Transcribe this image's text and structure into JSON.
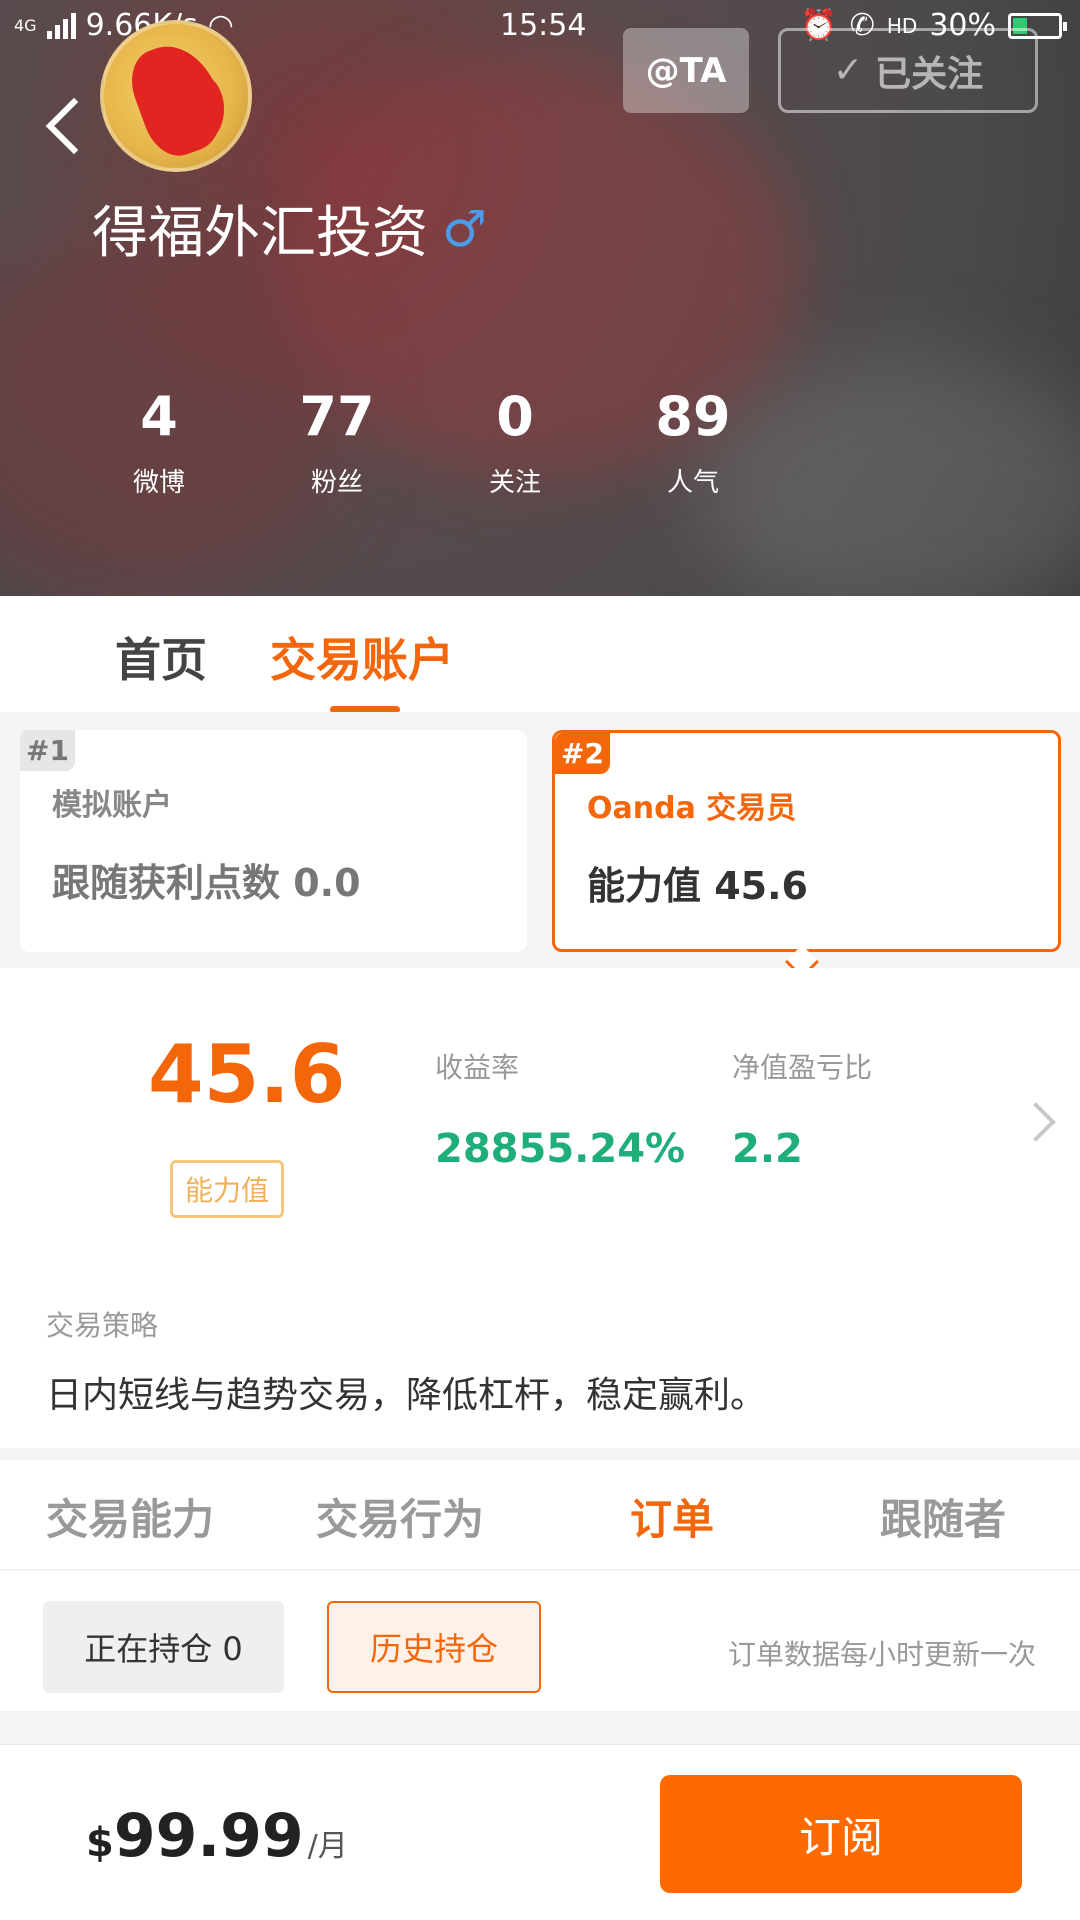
{
  "status_bar": {
    "network": "4G",
    "speed": "9.66K/s",
    "time": "15:54",
    "call_status": "HD",
    "battery": "30%"
  },
  "profile": {
    "name": "得福外汇投资",
    "gender_symbol": "♂",
    "at_button": "@TA",
    "follow_button": "已关注",
    "stats": [
      {
        "value": "4",
        "label": "微博"
      },
      {
        "value": "77",
        "label": "粉丝"
      },
      {
        "value": "0",
        "label": "关注"
      },
      {
        "value": "89",
        "label": "人气"
      }
    ]
  },
  "main_tabs": [
    "首页",
    "交易账户"
  ],
  "accounts": [
    {
      "badge": "#1",
      "title": "模拟账户",
      "value": "跟随获利点数 0.0"
    },
    {
      "badge": "#2",
      "title": "Oanda 交易员",
      "value": "能力值 45.6"
    }
  ],
  "ability": {
    "value": "45.6",
    "tag": "能力值",
    "metrics": [
      {
        "label": "收益率",
        "value": "28855.24%"
      },
      {
        "label": "净值盈亏比",
        "value": "2.2"
      }
    ]
  },
  "strategy": {
    "label": "交易策略",
    "text": "日内短线与趋势交易，降低杠杆，稳定赢利。"
  },
  "sub_tabs": [
    "交易能力",
    "交易行为",
    "订单",
    "跟随者"
  ],
  "filters": {
    "current": "正在持仓 0",
    "history": "历史持仓",
    "note": "订单数据每小时更新一次"
  },
  "bottom": {
    "currency": "$",
    "price": "99.99",
    "period": "/月",
    "subscribe": "订阅"
  },
  "colors": {
    "accent": "#f4660a",
    "positive": "#1fae79"
  }
}
